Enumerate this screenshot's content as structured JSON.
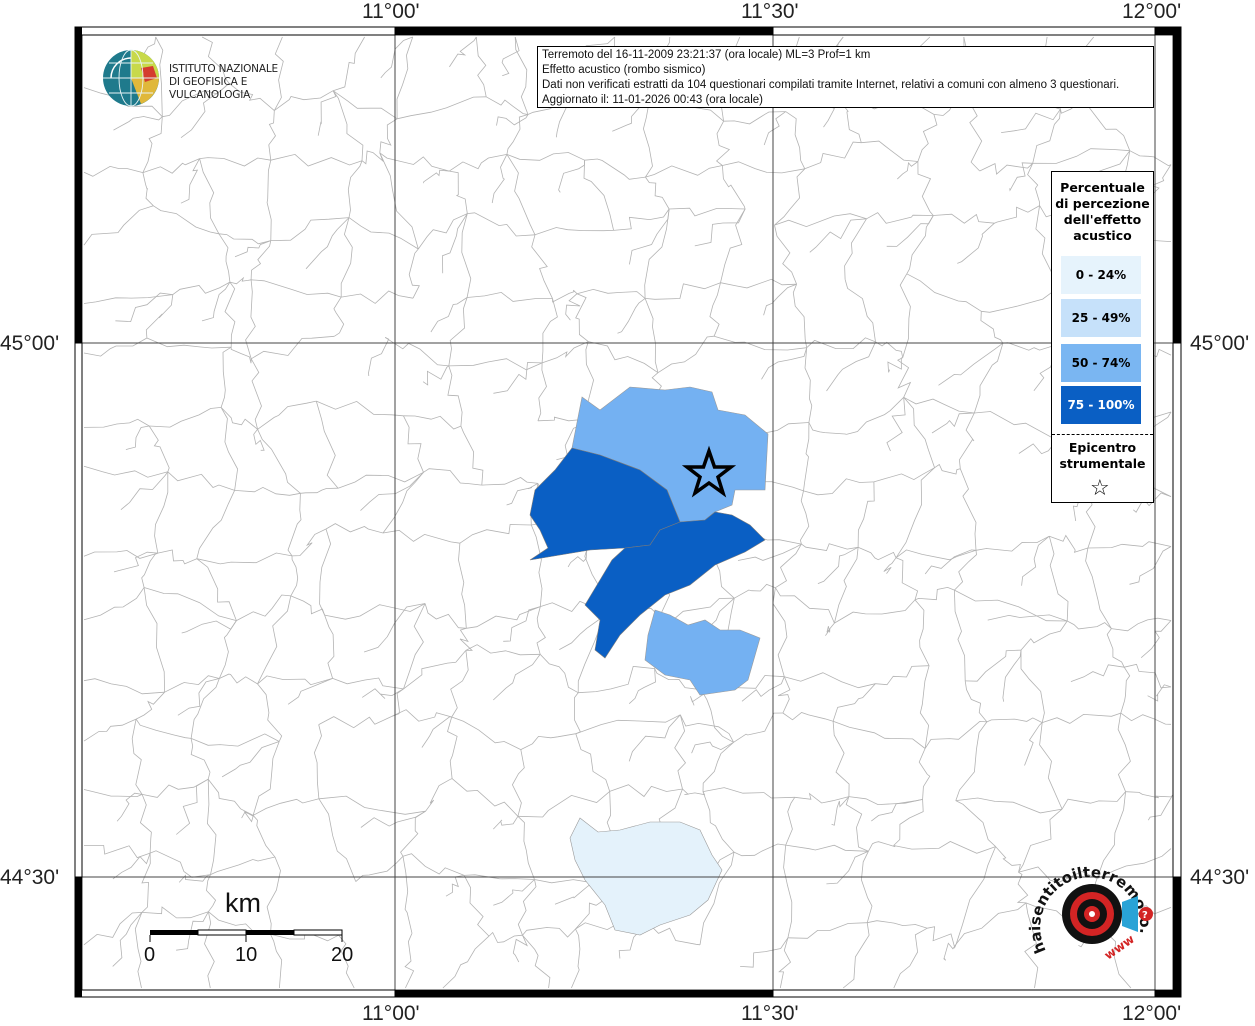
{
  "map": {
    "lon_labels": [
      "11°00'",
      "11°30'",
      "12°00'"
    ],
    "lat_labels": [
      "45°00'",
      "44°30'"
    ]
  },
  "info": {
    "line1": "Terremoto del 16-11-2009 23:21:37 (ora locale) ML=3 Prof=1 km",
    "line2": "Effetto acustico (rombo sismico)",
    "line3": "Dati non verificati estratti da 104 questionari compilati tramite Internet, relativi a comuni con almeno 3 questionari.",
    "line4": "Aggiornato il: 11-01-2026 00:43 (ora locale)"
  },
  "logo": {
    "line1": "ISTITUTO NAZIONALE",
    "line2": "DI GEOFISICA E VULCANOLOGIA"
  },
  "legend": {
    "title": [
      "Percentuale",
      "di percezione",
      "dell'effetto",
      "acustico"
    ],
    "classes": [
      {
        "label": "0 - 24%",
        "color": "#e6f3fc",
        "text_color": "#000000"
      },
      {
        "label": "25 - 49%",
        "color": "#c6e1fa",
        "text_color": "#000000"
      },
      {
        "label": "50 - 74%",
        "color": "#7ab6f2",
        "text_color": "#000000"
      },
      {
        "label": "75 - 100%",
        "color": "#0a5fc4",
        "text_color": "#ffffff"
      }
    ],
    "epicenter_label": [
      "Epicentro",
      "strumentale"
    ],
    "epicenter_icon": "star-outline-icon"
  },
  "scale": {
    "unit": "km",
    "ticks": [
      "0",
      "10",
      "20"
    ]
  },
  "colors": {
    "c75": "#0a5fc4",
    "c50": "#74b1f2",
    "c0": "#e4f2fb",
    "border": "#aaaaaa"
  },
  "secondary_logo": {
    "text": "haisentitoilterremoto.it",
    "url_text": "www"
  }
}
